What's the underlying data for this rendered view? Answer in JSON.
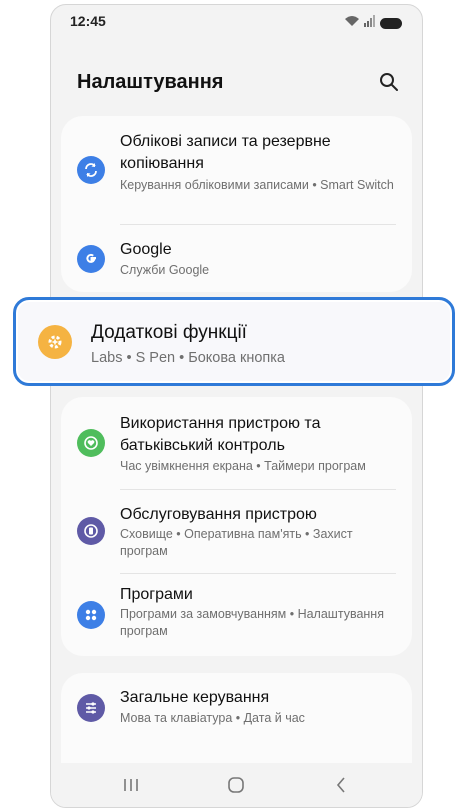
{
  "status_bar": {
    "time": "12:45"
  },
  "header": {
    "title": "Налаштування"
  },
  "card1": {
    "items": [
      {
        "title": "Облікові записи та резервне копіювання",
        "subtitle": "Керування обліковими записами • Smart Switch",
        "icon": "sync-icon",
        "color": "#3d7fe6"
      },
      {
        "title": "Google",
        "subtitle": "Служби Google",
        "icon": "google-icon",
        "color": "#3d7fe6"
      }
    ]
  },
  "highlighted_item": {
    "title": "Додаткові функції",
    "subtitle": "Labs  •  S Pen  •  Бокова кнопка",
    "icon": "gear-plus-icon",
    "color": "#f5b342"
  },
  "card2": {
    "items": [
      {
        "title": "Використання пристрою та батьківський контроль",
        "subtitle": "Час увімкнення екрана • Таймери програм",
        "icon": "heart-shield-icon",
        "color": "#4fbd5c"
      },
      {
        "title": "Обслуговування пристрою",
        "subtitle": "Сховище • Оперативна пам'ять • Захист програм",
        "icon": "device-care-icon",
        "color": "#5f5aa6"
      },
      {
        "title": "Програми",
        "subtitle": "Програми за замовчуванням • Налаштування програм",
        "icon": "apps-grid-icon",
        "color": "#3d7fe6"
      }
    ]
  },
  "card3": {
    "items": [
      {
        "title": "Загальне керування",
        "subtitle": "Мова та клавіатура • Дата й час",
        "icon": "sliders-icon",
        "color": "#5f5aa6"
      }
    ]
  },
  "colors": {
    "accent": "#2f7ad8",
    "background": "#f3f3f3",
    "card": "#fbfbfb"
  }
}
